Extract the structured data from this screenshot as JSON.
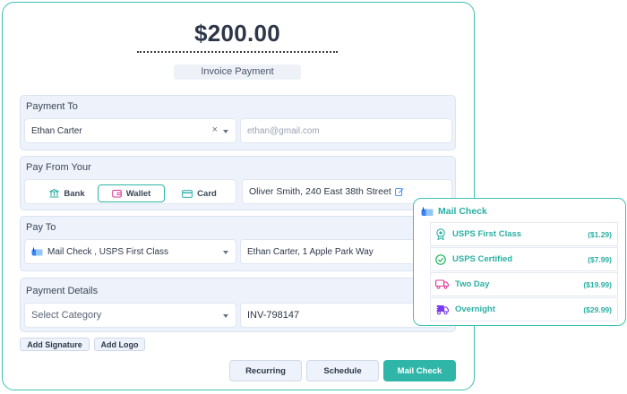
{
  "amount": "$200.00",
  "memo": "Invoice Payment",
  "payment_to": {
    "title": "Payment To",
    "payee": "Ethan Carter",
    "clear_symbol": "×",
    "email_placeholder": "ethan@gmail.com"
  },
  "pay_from": {
    "title": "Pay From Your",
    "tabs": [
      {
        "label": "Bank",
        "icon": "bank-icon"
      },
      {
        "label": "Wallet",
        "icon": "wallet-icon"
      },
      {
        "label": "Card",
        "icon": "card-icon"
      }
    ],
    "active_tab": "Wallet",
    "address": "Oliver Smith, 240 East 38th Street"
  },
  "pay_to": {
    "title": "Pay To",
    "method": "Mail Check , USPS First Class",
    "recipient": "Ethan Carter, 1 Apple Park Way"
  },
  "payment_details": {
    "title": "Payment Details",
    "category_placeholder": "Select Category",
    "invoice": "INV-798147"
  },
  "buttons": {
    "add_signature": "Add Signature",
    "add_logo": "Add Logo",
    "recurring": "Recurring",
    "schedule": "Schedule",
    "mail_check": "Mail Check"
  },
  "mail_popup": {
    "title": "Mail Check",
    "options": [
      {
        "name": "USPS First Class",
        "price": "($1.29)",
        "icon": "ribbon-icon",
        "color": "#2bb0a4"
      },
      {
        "name": "USPS Certified",
        "price": "($7.99)",
        "icon": "check-circle-icon",
        "color": "#22b35e"
      },
      {
        "name": "Two Day",
        "price": "($19.99)",
        "icon": "truck-icon",
        "color": "#e0379b"
      },
      {
        "name": "Overnight",
        "price": "($29.99)",
        "icon": "fast-truck-icon",
        "color": "#7c3aed"
      }
    ]
  },
  "colors": {
    "accent": "#2fb6a9",
    "border": "#3fc1b4",
    "section_bg": "#eef3fb"
  }
}
